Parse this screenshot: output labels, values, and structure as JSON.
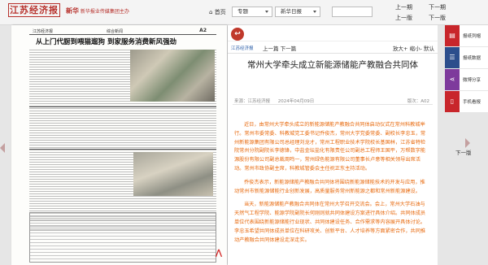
{
  "header": {
    "logo": "江苏经济报",
    "group_name_bold": "新华",
    "group_name": "新华报业传媒集团主办",
    "home": "首页",
    "topic": "专题",
    "newspaper": "新华日报",
    "prev_edition": "上一期",
    "next_edition": "下一期",
    "prev_page": "上一版",
    "next_page": "下一版"
  },
  "left_page": {
    "edition": "江苏经济报",
    "section": "综合新闻",
    "page_no": "A2",
    "headline": "从上门代厨到喂猫遛狗 到家服务消费新风强劲",
    "pdf_label": "下载"
  },
  "next_label": "下一版",
  "article": {
    "edition_link": "江苏经济报",
    "pager": "上一篇 下一篇",
    "zoom_in": "放大+",
    "zoom_out": "缩小-",
    "default": "默认",
    "title": "常州大学牵头成立新能源储能产教融合共同体",
    "source": "来源：江苏经济报",
    "date": "2024年04月09日",
    "page": "版次：A02",
    "paragraphs": [
      "近日，由常州大学牵头成立的新能源储能产教融合共同体启动仪式在常州科教城举行。常州市委常委、科教城党工委书记乔俊杰，常州大学党委常委、副校长李忠玉，常州新能源集团有限公司总经理刘龙才，常州工程职业技术学院校长基国林，江苏省特检院常州分院副院长李德锋，中盐金坛盐化有限责任公司副总工程师王国平，万帮数字能源股份有限公司副总裁周鸣一，常州绿色能源有限公司董事长卢意等相关领导出席活动。常州市政协副主席，科教城管委会主任祝正东主持活动。",
      "乔俊杰表示，新能源储能产教融合共同体将围绕新能源储能技术的开发与应用，推动常州市新能源储能行业创新发展，高质量服务常州新能源之都和常州新能源建设。",
      "当天，新能源储能产教融合共同体在常州大学召开交流会。会上，常州大学石油与天然气工程学院、能源学院副院长何刚则就共同体建设方案进行具体介绍。共同体成员单位代表围绕新能源储能行业现状、共同体建设任务、合作需求等内容展开具体讨论。李忠玉希望共同体成员单位在科研攻关、创新平台、人才培养等方面紧密合作，共同推动产教融合共同体建设走深走实。"
    ]
  },
  "sidebar": [
    {
      "label": "报纸列帽",
      "color": "#c8262b",
      "icon": "newspaper-icon"
    },
    {
      "label": "报纸数据",
      "color": "#2c4e8c",
      "icon": "list-icon"
    },
    {
      "label": "微博分享",
      "color": "#7e3a9c",
      "icon": "share-icon"
    },
    {
      "label": "手机看报",
      "color": "#c8262b",
      "icon": "phone-icon"
    }
  ]
}
